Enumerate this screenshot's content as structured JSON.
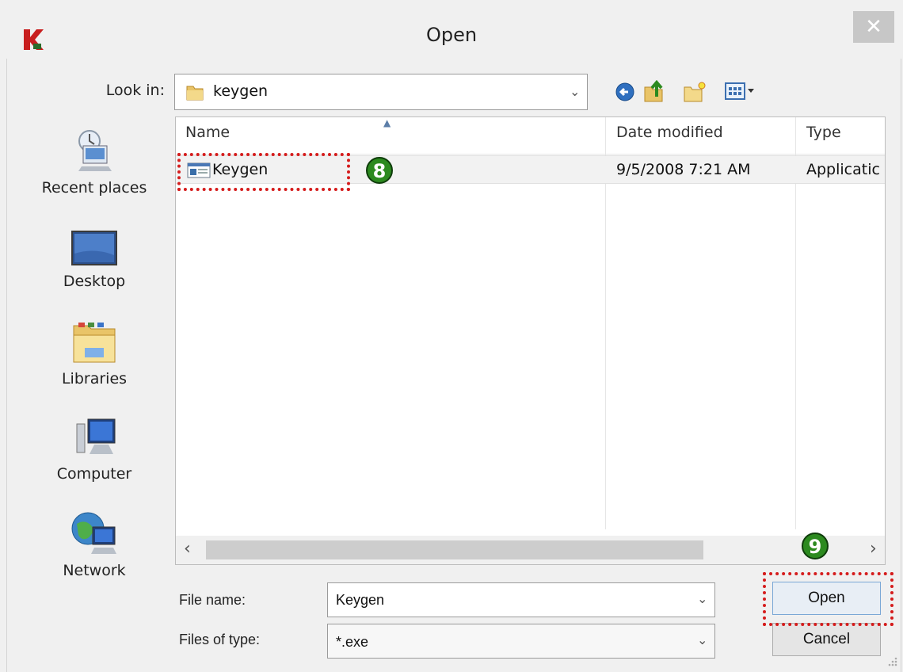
{
  "window": {
    "title": "Open",
    "close_glyph": "✕"
  },
  "lookin": {
    "label": "Look in:",
    "value": "keygen"
  },
  "toolbar": {
    "icons": [
      "back-icon",
      "up-folder-icon",
      "new-folder-icon",
      "view-menu-icon"
    ]
  },
  "places": [
    {
      "label": "Recent places",
      "icon": "recent-places-icon"
    },
    {
      "label": "Desktop",
      "icon": "desktop-icon"
    },
    {
      "label": "Libraries",
      "icon": "libraries-icon"
    },
    {
      "label": "Computer",
      "icon": "computer-icon"
    },
    {
      "label": "Network",
      "icon": "network-icon"
    }
  ],
  "columns": {
    "name": "Name",
    "date": "Date modified",
    "type": "Type"
  },
  "files": [
    {
      "name": "Keygen",
      "date": "9/5/2008 7:21 AM",
      "type": "Applicatic"
    }
  ],
  "filename": {
    "label": "File name:",
    "value": "Keygen"
  },
  "filetype": {
    "label": "Files of type:",
    "value": "*.exe"
  },
  "buttons": {
    "open": "Open",
    "cancel": "Cancel"
  },
  "annotations": {
    "step_file": "8",
    "step_open": "9",
    "marker_color": "#d51c1c",
    "badge_color": "#2c8a1f"
  },
  "scroll": {
    "left_glyph": "‹",
    "right_glyph": "›"
  }
}
